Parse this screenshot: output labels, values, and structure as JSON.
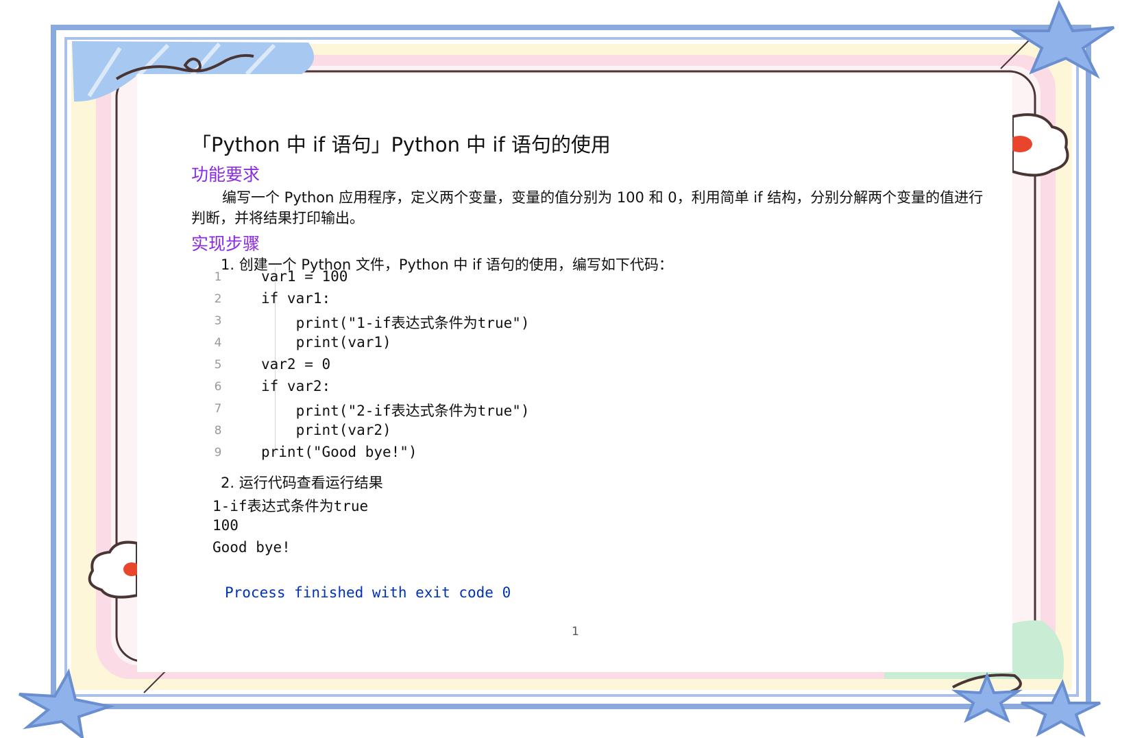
{
  "document": {
    "title": "「Python 中 if 语句」Python 中 if 语句的使用",
    "section_requirements": "功能要求",
    "requirements_text": "编写一个 Python 应用程序，定义两个变量，变量的值分别为 100 和 0，利用简单 if 结构，分别分解两个变量的值进行判断，并将结果打印输出。",
    "section_steps": "实现步骤",
    "step1": "1. 创建一个 Python 文件，Python 中 if 语句的使用，编写如下代码：",
    "step2": "2. 运行代码查看运行结果",
    "code_lines": [
      {
        "n": "1",
        "text": "var1 = 100"
      },
      {
        "n": "2",
        "text": "if var1:"
      },
      {
        "n": "3",
        "text": "    print(\"1-if表达式条件为true\")"
      },
      {
        "n": "4",
        "text": "    print(var1)"
      },
      {
        "n": "5",
        "text": "var2 = 0"
      },
      {
        "n": "6",
        "text": "if var2:"
      },
      {
        "n": "7",
        "text": "    print(\"2-if表达式条件为true\")"
      },
      {
        "n": "8",
        "text": "    print(var2)"
      },
      {
        "n": "9",
        "text": "print(\"Good bye!\")"
      }
    ],
    "output_lines": [
      "1-if表达式条件为true",
      "100",
      "Good bye!"
    ],
    "process_line": "Process finished with exit code 0",
    "page_number": "1"
  },
  "colors": {
    "heading": "#8a2be2",
    "keyword": "#0033b3",
    "number": "#1750eb",
    "string": "#067d17",
    "frame_blue": "#7b9fd8",
    "frame_pink": "#f9d6e3",
    "frame_cream": "#fdf6d8",
    "frame_brown": "#4a3535"
  },
  "icons": [
    "star-icon",
    "cloud-icon",
    "swirl-icon"
  ]
}
